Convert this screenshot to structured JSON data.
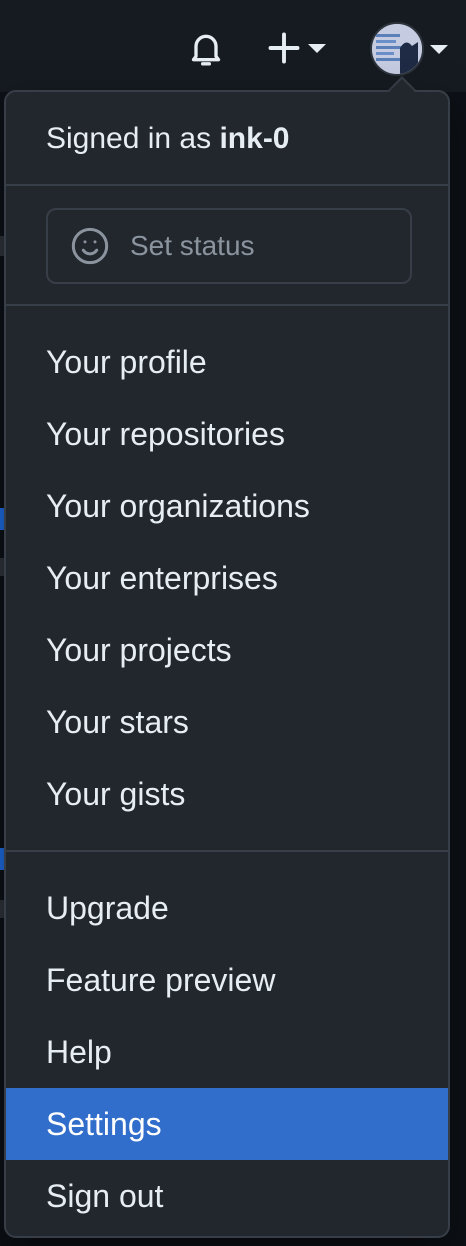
{
  "header": {
    "notifications_icon": "bell-icon",
    "create_icon": "plus-icon",
    "avatar_icon": "avatar"
  },
  "dropdown": {
    "signed_in_prefix": "Signed in as",
    "username": "ink-0",
    "status_placeholder": "Set status",
    "status_icon": "smiley-icon",
    "groups": [
      [
        "Your profile",
        "Your repositories",
        "Your organizations",
        "Your enterprises",
        "Your projects",
        "Your stars",
        "Your gists"
      ],
      [
        "Upgrade",
        "Feature preview",
        "Help",
        "Settings",
        "Sign out"
      ]
    ],
    "active_item": "Settings"
  },
  "colors": {
    "background": "#22272e",
    "border": "#373e47",
    "text": "#e6edf3",
    "muted": "#8b949e",
    "accent": "#316dca"
  }
}
